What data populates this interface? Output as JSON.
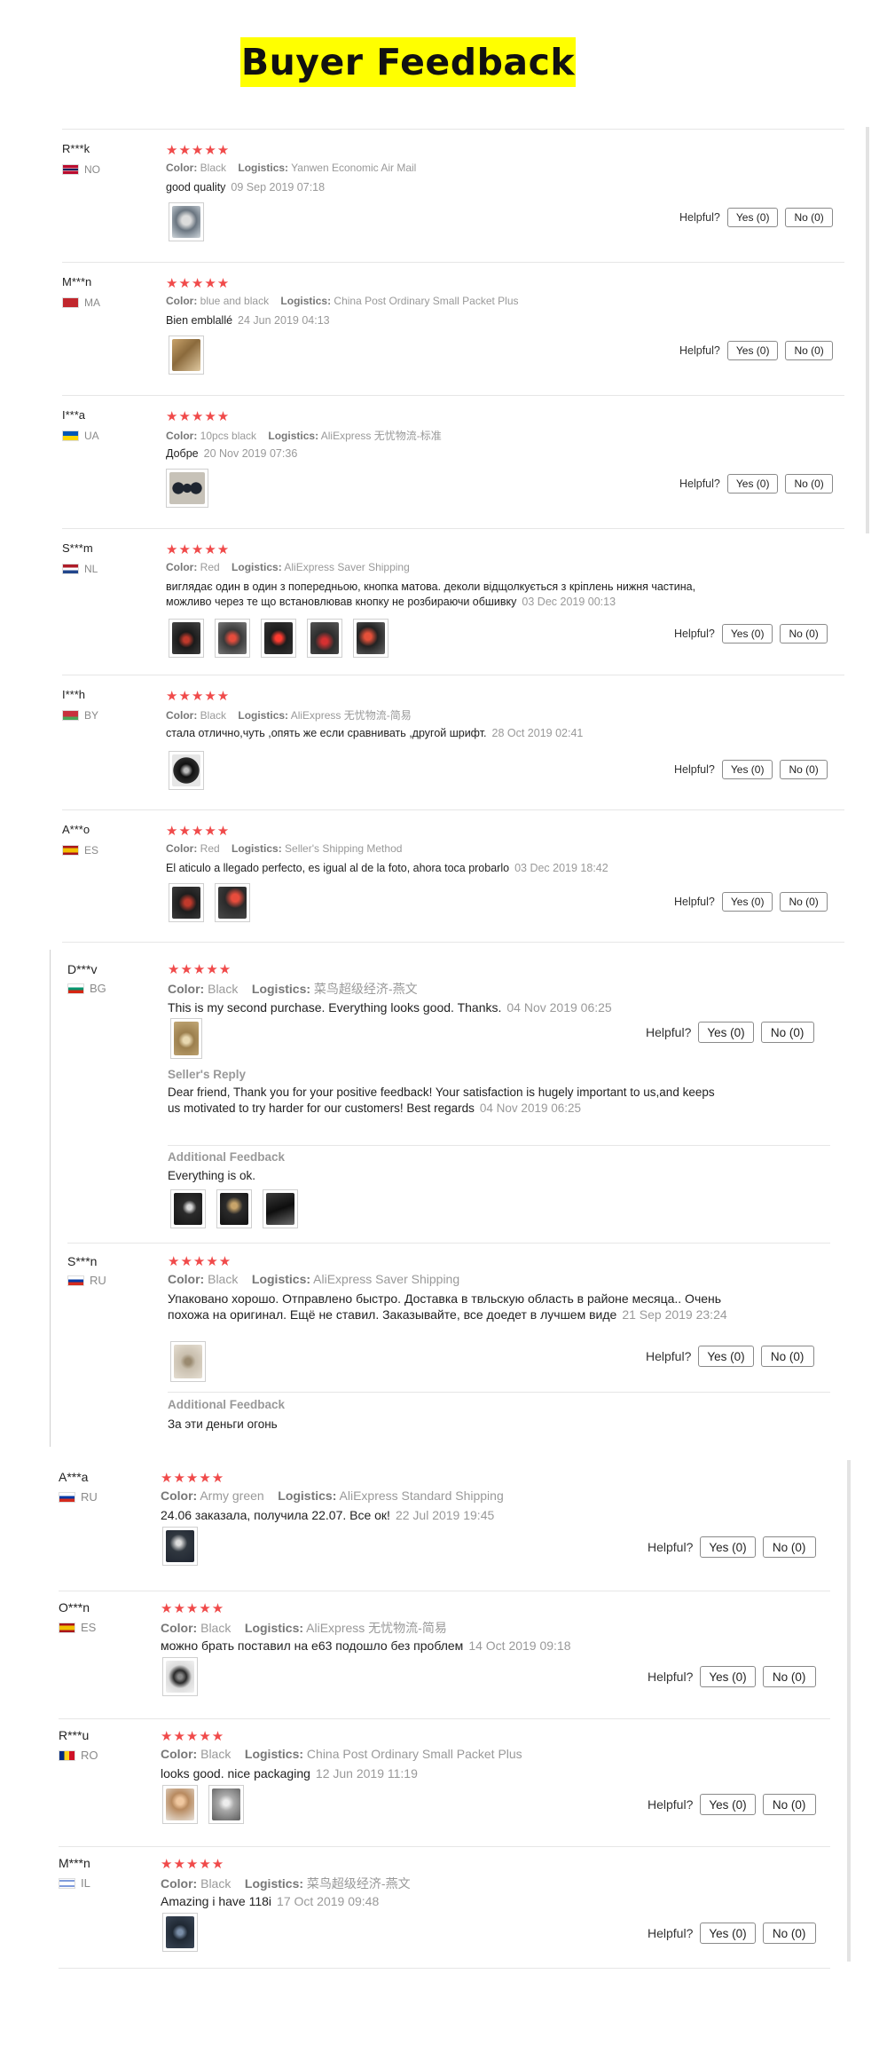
{
  "banner": {
    "title": "Buyer Feedback"
  },
  "labels": {
    "color": "Color:",
    "logistics": "Logistics:",
    "helpful": "Helpful?",
    "seller_reply": "Seller's Reply",
    "additional_feedback": "Additional Feedback"
  },
  "stars": "★★★★★",
  "reviews": [
    {
      "user": "R***k",
      "country": "NO",
      "color": "Black",
      "logistics": "Yanwen Economic Air Mail",
      "text": "good quality",
      "date": "09 Sep 2019 07:18",
      "yes": "Yes (0)",
      "no": "No (0)"
    },
    {
      "user": "M***n",
      "country": "MA",
      "color": "blue and black",
      "logistics": "China Post Ordinary Small Packet Plus",
      "text": "Bien emblallé",
      "date": "24 Jun 2019 04:13",
      "yes": "Yes (0)",
      "no": "No (0)"
    },
    {
      "user": "I***a",
      "country": "UA",
      "color": "10pcs black",
      "logistics": "AliExpress 无忧物流-标准",
      "text": "Добре",
      "date": "20 Nov 2019 07:36",
      "yes": "Yes (0)",
      "no": "No (0)"
    },
    {
      "user": "S***m",
      "country": "NL",
      "color": "Red",
      "logistics": "AliExpress Saver Shipping",
      "text": "виглядає один в один з попередньою, кнопка матова. деколи відщолкується з кріплень нижня частина, можливо через те що встановлював кнопку не розбираючи обшивку",
      "date": "03 Dec 2019 00:13",
      "yes": "Yes (0)",
      "no": "No (0)"
    },
    {
      "user": "I***h",
      "country": "BY",
      "color": "Black",
      "logistics": "AliExpress 无忧物流-简易",
      "text": "стала отлично,чуть ,опять же если сравнивать ,другой шрифт.",
      "date": "28 Oct 2019 02:41",
      "yes": "Yes (0)",
      "no": "No (0)"
    },
    {
      "user": "A***o",
      "country": "ES",
      "color": "Red",
      "logistics": "Seller's Shipping Method",
      "text": "El aticulo a llegado perfecto, es igual al de la foto, ahora toca probarlo",
      "date": "03 Dec 2019 18:42",
      "yes": "Yes (0)",
      "no": "No (0)"
    },
    {
      "user": "D***v",
      "country": "BG",
      "color": "Black",
      "logistics": "菜鸟超级经济-燕文",
      "text": "This is my second purchase. Everything looks good. Thanks.",
      "date": "04 Nov 2019 06:25",
      "yes": "Yes (0)",
      "no": "No (0)",
      "reply": "Dear friend, Thank you for your positive feedback! Your satisfaction is hugely important to us,and keeps us motivated to try harder for our customers! Best regards",
      "reply_date": "04 Nov 2019 06:25",
      "additional": "Everything is ok."
    },
    {
      "user": "S***n",
      "country": "RU",
      "color": "Black",
      "logistics": "AliExpress Saver Shipping",
      "text": "Упаковано хорошо. Отправлено быстро. Доставка в твльскую область в районе месяца.. Очень похожа на оригинал. Ещё не ставил. Заказывайте, все доедет в лучшем виде",
      "date": "21 Sep 2019 23:24",
      "yes": "Yes (0)",
      "no": "No (0)",
      "additional": "За эти деньги огонь"
    },
    {
      "user": "A***a",
      "country": "RU",
      "color": "Army green",
      "logistics": "AliExpress Standard Shipping",
      "text": "24.06 заказала, получила 22.07. Все ок!",
      "date": "22 Jul 2019 19:45",
      "yes": "Yes (0)",
      "no": "No (0)"
    },
    {
      "user": "O***n",
      "country": "ES",
      "color": "Black",
      "logistics": "AliExpress 无忧物流-简易",
      "text": "можно брать поставил на е63 подошло без проблем",
      "date": "14 Oct 2019 09:18",
      "yes": "Yes (0)",
      "no": "No (0)"
    },
    {
      "user": "R***u",
      "country": "RO",
      "color": "Black",
      "logistics": "China Post Ordinary Small Packet Plus",
      "text": "looks good. nice packaging",
      "date": "12 Jun 2019 11:19",
      "yes": "Yes (0)",
      "no": "No (0)"
    },
    {
      "user": "M***n",
      "country": "IL",
      "color": "Black",
      "logistics": "菜鸟超级经济-燕文",
      "text": "Amazing i have 118i",
      "date": "17 Oct 2019 09:48",
      "yes": "Yes (0)",
      "no": "No (0)"
    }
  ]
}
